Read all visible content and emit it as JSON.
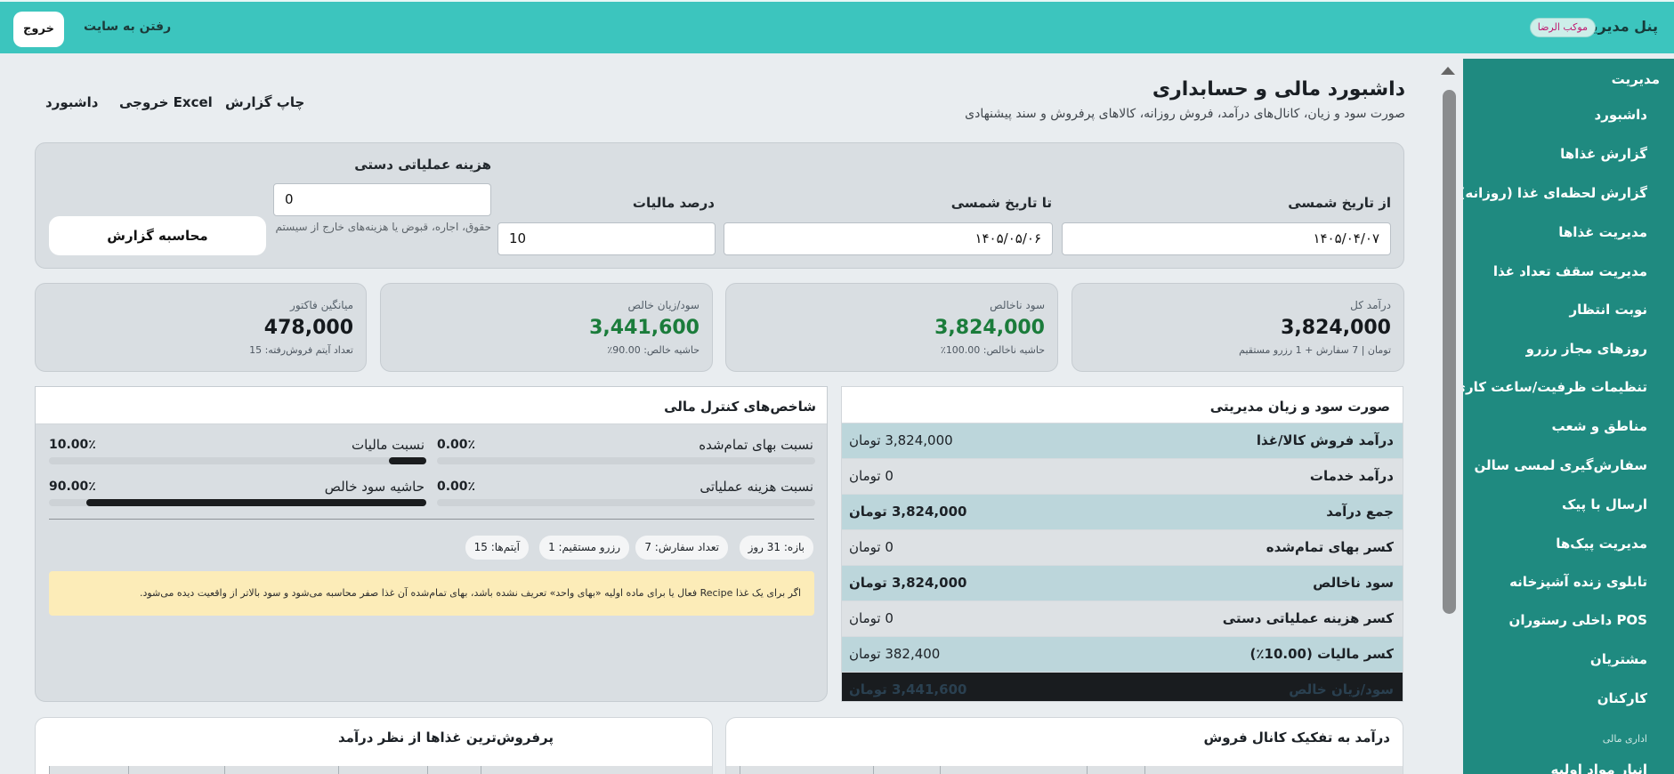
{
  "topbar": {
    "brand": "پنل مدیریت",
    "badge": "موکب الرضا",
    "site_link": "رفتن به سایت",
    "logout": "خروج"
  },
  "sidebar": {
    "heading": "مدیریت",
    "items": [
      "داشبورد",
      "گزارش غذاها",
      "گزارش لحظه‌ای غذا (روزانه)",
      "مدیریت غذاها",
      "مدیریت سقف تعداد غذا",
      "نوبت انتظار",
      "روزهای مجاز رزرو",
      "تنظیمات ظرفیت/ساعت کاری",
      "مناطق و شعب",
      "سفارش‌گیری لمسی سالن",
      "ارسال با پیک",
      "مدیریت پیک‌ها",
      "تابلوی زنده آشپزخانه",
      "POS داخلی رستوران",
      "مشتریان",
      "کارکنان"
    ],
    "section": "اداری مالی",
    "cut_item": "انبار مواد اولیه"
  },
  "header": {
    "title": "داشبورد مالی و حسابداری",
    "subtitle": "صورت سود و زیان، کانال‌های درآمد، فروش روزانه، کالاهای پرفروش و سند پیشنهادی",
    "links": {
      "print": "چاپ گزارش",
      "excel": "خروجی Excel",
      "dashboard": "داشبورد"
    }
  },
  "filters": {
    "from_label": "از تاریخ شمسی",
    "from_value": "۱۴۰۵/۰۴/۰۷",
    "to_label": "تا تاریخ شمسی",
    "to_value": "۱۴۰۵/۰۵/۰۶",
    "tax_label": "درصد مالیات",
    "tax_value": "10",
    "opcost_label": "هزینه عملیاتی دستی",
    "opcost_value": "0",
    "opcost_help": "حقوق، اجاره، قبوض یا هزینه‌های خارج از سیستم",
    "calc_button": "محاسبه گزارش"
  },
  "kpis": [
    {
      "label": "درآمد کل",
      "value": "3,824,000",
      "note": "تومان | 7 سفارش + 1 رزرو مستقیم",
      "color": "#15191d"
    },
    {
      "label": "سود ناخالص",
      "value": "3,824,000",
      "note": "حاشیه ناخالص: 100.00٪",
      "color": "#1b7c3b"
    },
    {
      "label": "سود/زیان خالص",
      "value": "3,441,600",
      "note": "حاشیه خالص: 90.00٪",
      "color": "#1b7c3b"
    },
    {
      "label": "میانگین فاکتور",
      "value": "478,000",
      "note": "تعداد آیتم فروش‌رفته: 15",
      "color": "#15191d"
    }
  ],
  "pl": {
    "title": "صورت سود و زیان مدیریتی",
    "rows": [
      {
        "label": "درآمد فروش کالا/غذا",
        "value": "3,824,000 تومان",
        "bold": false
      },
      {
        "label": "درآمد خدمات",
        "value": "0 تومان",
        "bold": false
      },
      {
        "label": "جمع درآمد",
        "value": "3,824,000 تومان",
        "bold": true
      },
      {
        "label": "کسر بهای تمام‌شده",
        "value": "0 تومان",
        "bold": false
      },
      {
        "label": "سود ناخالص",
        "value": "3,824,000 تومان",
        "bold": true
      },
      {
        "label": "کسر هزینه عملیاتی دستی",
        "value": "0 تومان",
        "bold": false
      },
      {
        "label": "کسر مالیات (10.00٪)",
        "value": "382,400 تومان",
        "bold": false
      },
      {
        "label": "سود/زیان خالص",
        "value": "3,441,600 تومان",
        "bold": true
      }
    ]
  },
  "indicators": {
    "title": "شاخص‌های کنترل مالی",
    "items": [
      {
        "label": "نسبت بهای تمام‌شده",
        "pct": "0.00٪",
        "level": 0.0
      },
      {
        "label": "نسبت مالیات",
        "pct": "10.00٪",
        "level": 0.1
      },
      {
        "label": "نسبت هزینه عملیاتی",
        "pct": "0.00٪",
        "level": 0.0
      },
      {
        "label": "حاشیه سود خالص",
        "pct": "90.00٪",
        "level": 0.9
      }
    ],
    "chips": [
      "بازه: 31 روز",
      "تعداد سفارش: 7",
      "رزرو مستقیم: 1",
      "آیتم‌ها: 15"
    ],
    "warning": "اگر برای یک غذا Recipe فعال یا برای ماده اولیه «بهای واحد» تعریف نشده باشد، بهای تمام‌شده آن غذا صفر محاسبه می‌شود و سود بالاتر از واقعیت دیده می‌شود."
  },
  "bottom": {
    "channel_title": "درآمد به تفکیک کانال فروش",
    "top_foods_title": "پرفروش‌ترین غذاها از نظر درآمد"
  }
}
